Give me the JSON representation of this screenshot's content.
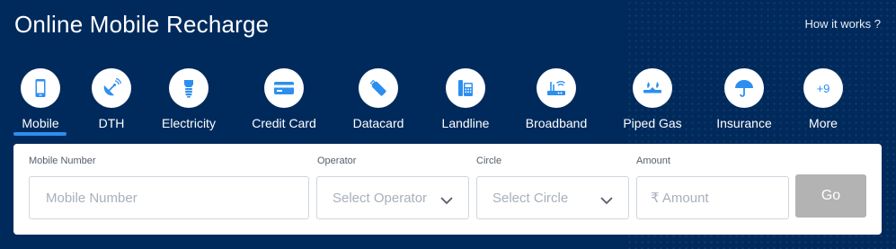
{
  "header": {
    "title": "Online Mobile Recharge",
    "how_it_works": "How it works ?"
  },
  "categories": [
    {
      "label": "Mobile",
      "icon": "mobile-icon",
      "active": true
    },
    {
      "label": "DTH",
      "icon": "satellite-dish-icon"
    },
    {
      "label": "Electricity",
      "icon": "bulb-icon"
    },
    {
      "label": "Credit Card",
      "icon": "credit-card-icon"
    },
    {
      "label": "Datacard",
      "icon": "usb-datacard-icon"
    },
    {
      "label": "Landline",
      "icon": "landline-phone-icon"
    },
    {
      "label": "Broadband",
      "icon": "router-icon"
    },
    {
      "label": "Piped Gas",
      "icon": "gas-flame-icon"
    },
    {
      "label": "Insurance",
      "icon": "umbrella-icon"
    },
    {
      "label": "More",
      "icon": "more-icon",
      "badge": "+9"
    }
  ],
  "form": {
    "mobile_label": "Mobile Number",
    "mobile_placeholder": "Mobile Number",
    "operator_label": "Operator",
    "operator_placeholder": "Select Operator",
    "circle_label": "Circle",
    "circle_placeholder": "Select Circle",
    "amount_label": "Amount",
    "amount_placeholder": "₹ Amount",
    "go_label": "Go"
  },
  "colors": {
    "background": "#002a5c",
    "accent": "#2c8ff0",
    "go_button": "#b3b3b3"
  }
}
